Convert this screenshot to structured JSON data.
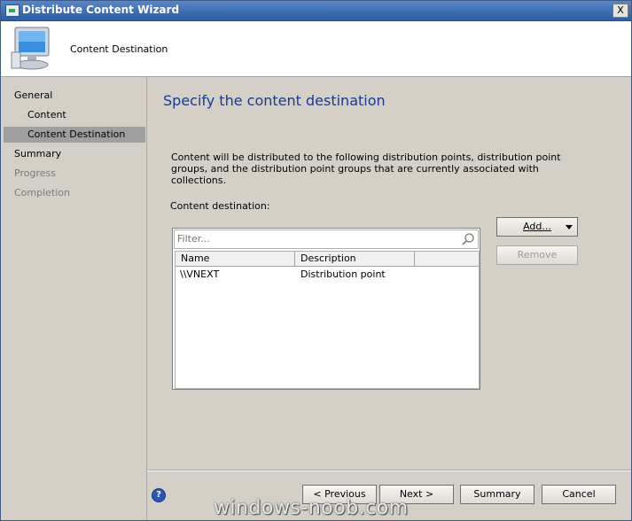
{
  "window": {
    "title": "Distribute Content Wizard",
    "close_label": "X"
  },
  "header": {
    "title": "Content Destination",
    "icon": "computer-monitor-icon"
  },
  "nav": {
    "items": [
      {
        "label": "General",
        "state": "normal"
      },
      {
        "label": "Content",
        "state": "normal"
      },
      {
        "label": "Content Destination",
        "state": "selected"
      },
      {
        "label": "Summary",
        "state": "normal"
      },
      {
        "label": "Progress",
        "state": "disabled"
      },
      {
        "label": "Completion",
        "state": "disabled"
      }
    ]
  },
  "main": {
    "heading": "Specify the content destination",
    "description": "Content will be distributed to the following distribution points, distribution point groups, and the distribution point groups that are currently associated with collections.",
    "destination_label": "Content destination:",
    "filter_placeholder": "Filter...",
    "table": {
      "columns": [
        "Name",
        "Description"
      ],
      "rows": [
        [
          "\\\\VNEXT",
          "Distribution point"
        ]
      ]
    },
    "add_label": "Add...",
    "remove_label": "Remove"
  },
  "footer": {
    "previous_label": "< Previous",
    "next_label": "Next >",
    "summary_label": "Summary",
    "cancel_label": "Cancel"
  },
  "watermark": "windows-noob.com",
  "colors": {
    "title_bar": "#3a6db3",
    "heading": "#1a3a8c",
    "nav_selected": "#9f9f9f"
  }
}
